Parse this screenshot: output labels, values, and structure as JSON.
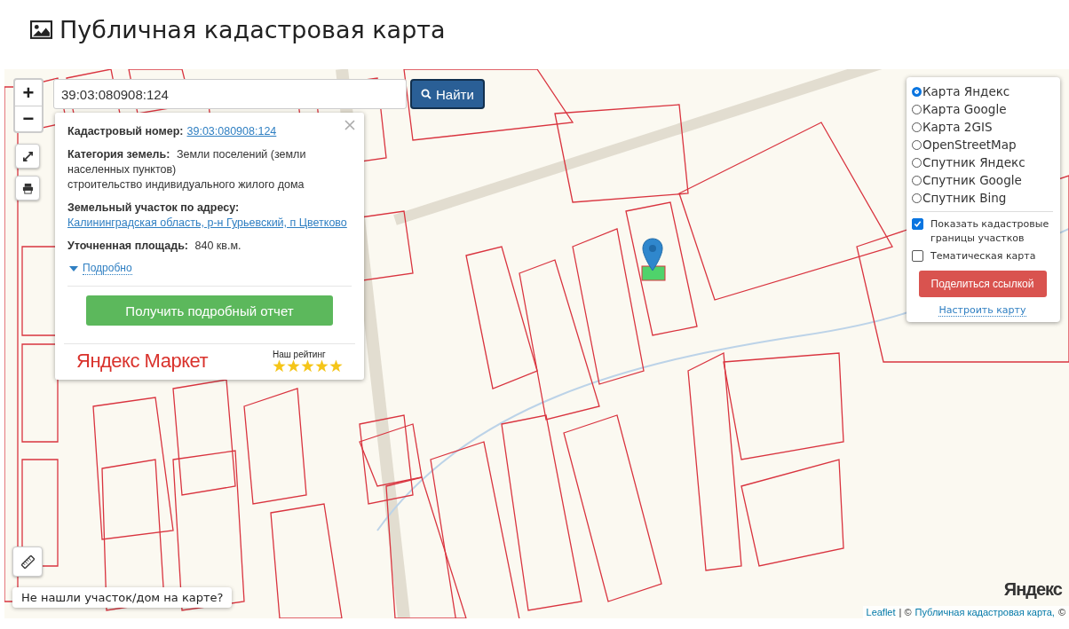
{
  "page": {
    "title": "Публичная кадастровая карта"
  },
  "search": {
    "value": "39:03:080908:124",
    "button": "Найти"
  },
  "map_controls": {
    "zoom_in": "+",
    "zoom_out": "−"
  },
  "popup": {
    "fields": [
      {
        "kind": "link",
        "label": "Кадастровый номер:",
        "value": "39:03:080908:124"
      },
      {
        "kind": "text",
        "label": "Категория земель:",
        "value": "Земли поселений (земли населенных пунктов)",
        "extra": "строительство индивидуального жилого дома"
      },
      {
        "kind": "link",
        "label": "Земельный участок по адресу:",
        "value": "Калининградская область, р-н Гурьевский, п Цветково"
      },
      {
        "kind": "text",
        "label": "Уточненная площадь:",
        "value": "840 кв.м."
      }
    ],
    "details_link": "Подробно",
    "report_button": "Получить подробный отчет",
    "ad": {
      "brand": "Яндекс Маркет",
      "rating_label": "Наш рейтинг",
      "stars": 5
    }
  },
  "layers": {
    "base_layers": [
      {
        "label": "Карта Яндекс",
        "selected": true
      },
      {
        "label": "Карта Google",
        "selected": false
      },
      {
        "label": "Карта 2GIS",
        "selected": false
      },
      {
        "label": "OpenStreetMap",
        "selected": false
      },
      {
        "label": "Спутник Яндекс",
        "selected": false
      },
      {
        "label": "Спутник Google",
        "selected": false
      },
      {
        "label": "Спутник Bing",
        "selected": false
      }
    ],
    "overlays": [
      {
        "label": "Показать кадастровые границы участков",
        "checked": true
      },
      {
        "label": "Тематическая карта",
        "checked": false
      }
    ],
    "share_button": "Поделиться ссылкой",
    "settings_link": "Настроить карту"
  },
  "not_found_hint": "Не нашли участок/дом на карте?",
  "map_logo": "Яндекс",
  "attribution": [
    {
      "kind": "link",
      "text": "Leaflet"
    },
    {
      "kind": "text",
      "text": "| ©"
    },
    {
      "kind": "link",
      "text": "Публичная кадастровая карта,"
    },
    {
      "kind": "text",
      "text": "©"
    }
  ]
}
